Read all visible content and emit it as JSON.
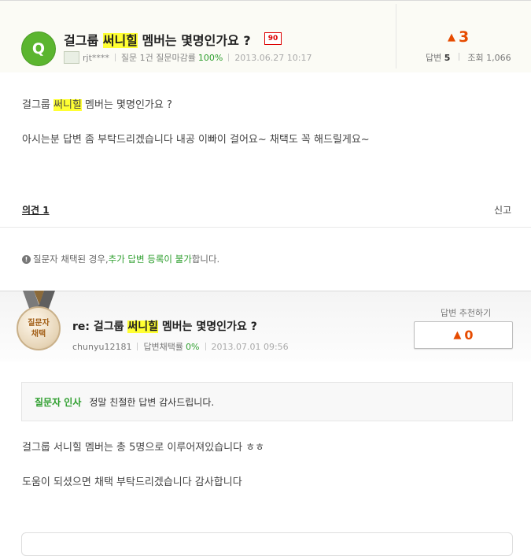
{
  "question": {
    "avatar_letter": "Q",
    "title_before": "걸그룹 ",
    "title_highlight": "써니힐",
    "title_after": " 멤버는 몇명인가요 ?",
    "point_badge": "90",
    "author": "rjt****",
    "stat_label": "질문 1건 질문마감률",
    "close_rate": "100%",
    "datetime": "2013.06.27 10:17",
    "likes": "3",
    "answers_label": "답변",
    "answers_count": "5",
    "views_label": "조회",
    "views_count": "1,066",
    "body_line1_before": " 걸그룹 ",
    "body_line1_highlight": "써니힐",
    "body_line1_after": " 멤버는 몇명인가요 ?",
    "body_line2": "아시는분 답변 좀 부탁드리겠습니다 내공 이빠이 걸어요~ 채택도 꼭 해드릴게요~"
  },
  "comments": {
    "label": "의견 1",
    "report": "신고"
  },
  "notice": {
    "before": "질문자 채택된 경우, ",
    "highlight": "추가 답변 등록이 불가",
    "after": "합니다."
  },
  "answer": {
    "medal_line1": "질문자",
    "medal_line2": "채택",
    "title_before": "re: 걸그룹 ",
    "title_highlight": "써니힐",
    "title_after": " 멤버는 몇명인가요 ?",
    "author": "chunyu12181",
    "adopt_label": "답변채택률",
    "adopt_rate": "0%",
    "datetime": "2013.07.01 09:56",
    "recommend_label": "답변 추천하기",
    "recommend_count": "0",
    "greeting_label": "질문자 인사",
    "greeting_text": "정말 친절한 답변 감사드립니다.",
    "body_line1": " 걸그룹 서니힐 멤버는 총 5명으로 이루어져있습니다 ㅎㅎ",
    "body_line2": "도움이 되셨으면 채택 부탁드리겠습니다 감사합니다"
  },
  "colors": {
    "accent_green": "#2d9e2d",
    "like_orange": "#e64b00",
    "highlight": "#ffff33"
  }
}
